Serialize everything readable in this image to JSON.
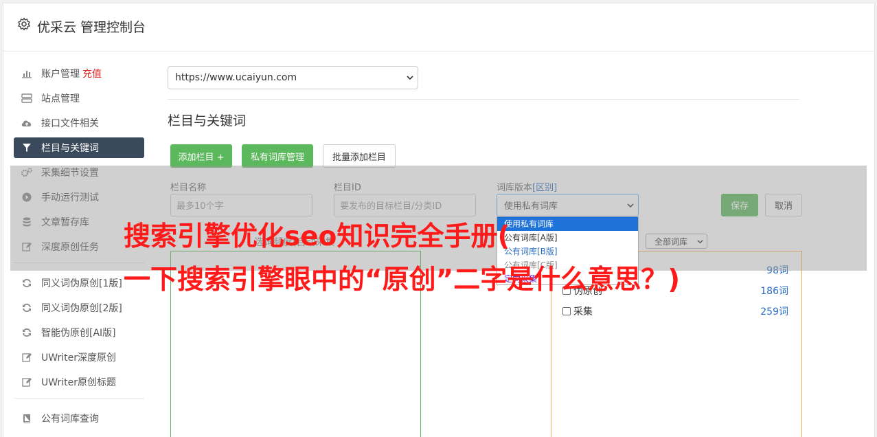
{
  "header": {
    "title": "优采云 管理控制台"
  },
  "sidebar": {
    "items": [
      {
        "label": "账户管理",
        "extra": "充值",
        "icon": "bar-chart-icon"
      },
      {
        "label": "站点管理",
        "icon": "server-icon"
      },
      {
        "label": "接口文件相关",
        "icon": "cloud-upload-icon"
      },
      {
        "label": "栏目与关键词",
        "icon": "filter-icon",
        "active": true
      },
      {
        "label": "采集细节设置",
        "icon": "gears-icon"
      },
      {
        "label": "手动运行测试",
        "icon": "play-circle-icon"
      },
      {
        "label": "文章暂存库",
        "icon": "database-icon"
      },
      {
        "label": "深度原创任务",
        "icon": "edit-icon"
      }
    ],
    "items2": [
      {
        "label": "同义词伪原创[1版]",
        "icon": "refresh-icon"
      },
      {
        "label": "同义词伪原创[2版]",
        "icon": "refresh-icon"
      },
      {
        "label": "智能伪原创[AI版]",
        "icon": "refresh-icon"
      },
      {
        "label": "UWriter深度原创",
        "icon": "edit-icon"
      },
      {
        "label": "UWriter原创标题",
        "icon": "edit-icon"
      }
    ],
    "items3": [
      {
        "label": "公有词库查询",
        "icon": "book-icon"
      }
    ]
  },
  "main": {
    "site_select": "https://www.ucaiyun.com",
    "section_title": "栏目与关键词",
    "buttons": {
      "add_column": "添加栏目 +",
      "private_lib": "私有词库管理",
      "batch_add": "批量添加栏目"
    },
    "form": {
      "name_label": "栏目名称",
      "name_placeholder": "最多10个字",
      "id_label": "栏目ID",
      "id_placeholder": "要发布的目标栏目/分类ID",
      "lib_label": "词库版本",
      "lib_label_link": "[区别]",
      "lib_value": "使用私有词库",
      "save": "保存",
      "cancel": "取消"
    },
    "dropdown_options": [
      "使用私有词库",
      "公有词库[A版]",
      "公有词库[B版]",
      "公有词库[C版]",
      "定向采集"
    ],
    "hidden_label": "选词频度(自动采集",
    "mini_select": "全部词库",
    "word_rows": [
      {
        "label": "",
        "count": "98词"
      },
      {
        "label": "伪原创",
        "count": "186词"
      },
      {
        "label": "采集",
        "count": "259词"
      }
    ]
  },
  "banner": {
    "line1": "搜索引擎优化seo知识完全手册(",
    "line2": "一下搜索引擎眼中的“原创”二字是什么意思？)"
  }
}
